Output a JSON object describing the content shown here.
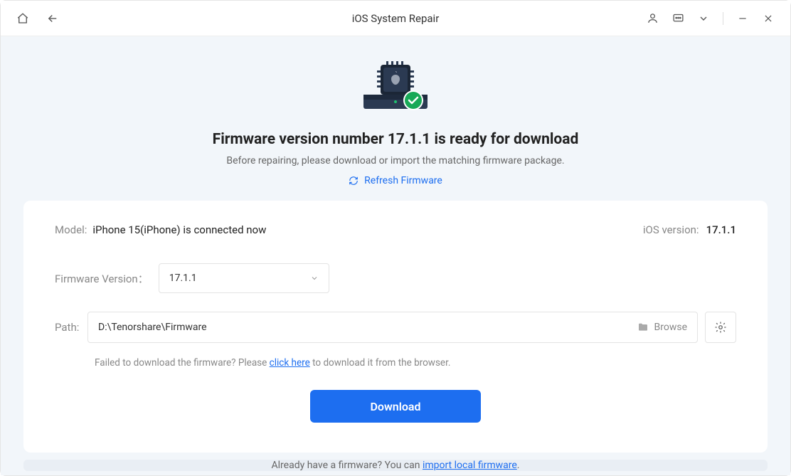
{
  "window": {
    "title": "iOS System Repair"
  },
  "headline": "Firmware version number 17.1.1 is ready for download",
  "subtext": "Before repairing, please download or import the matching firmware package.",
  "refresh_label": "Refresh Firmware",
  "model_label": "Model:",
  "model_value": "iPhone 15(iPhone) is connected now",
  "ios_version_label": "iOS version:",
  "ios_version_value": "17.1.1",
  "firmware_version_label": "Firmware Version：",
  "firmware_version_value": "17.1.1",
  "path_label": "Path:",
  "path_value": "D:\\Tenorshare\\Firmware",
  "browse_label": "Browse",
  "hint_prefix": "Failed to download the firmware? Please ",
  "hint_link": "click here",
  "hint_suffix": " to download it from the browser.",
  "download_button": "Download",
  "bottom_prefix": "Already have a firmware? You can ",
  "bottom_link": "import local firmware",
  "bottom_suffix": "."
}
